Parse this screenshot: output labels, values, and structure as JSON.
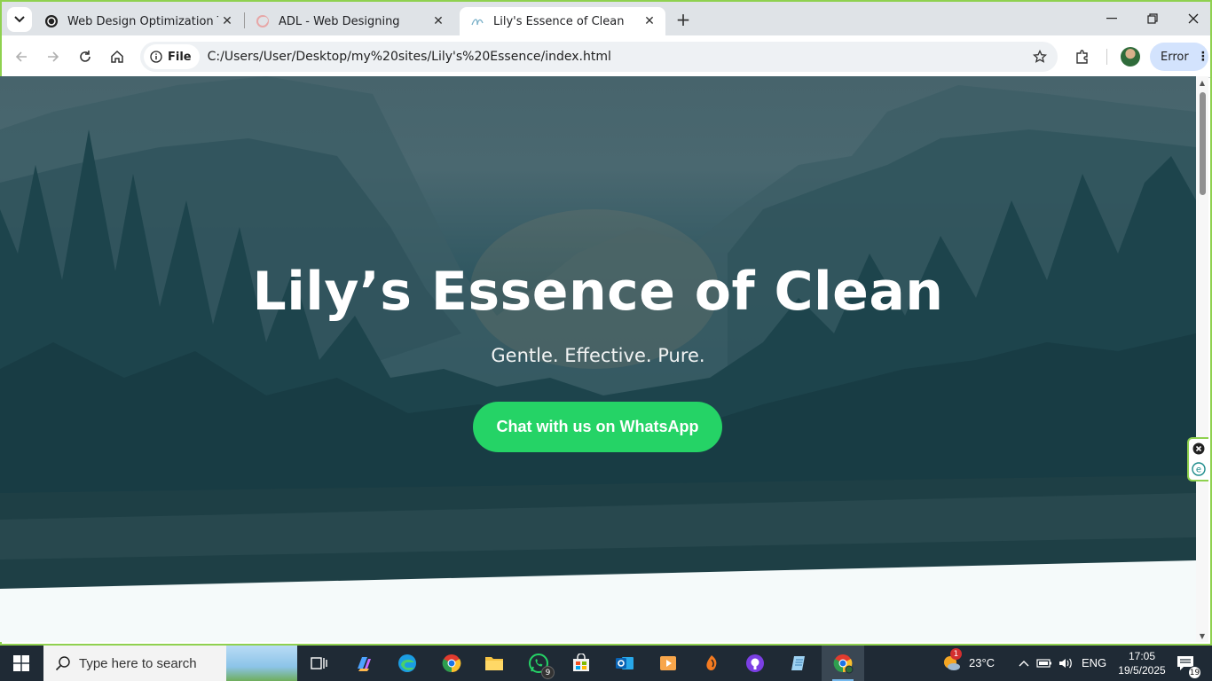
{
  "browser": {
    "tabs": [
      {
        "title": "Web Design Optimization Tips",
        "icon": "chatgpt-icon"
      },
      {
        "title": "ADL - Web Designing",
        "icon": "adl-icon"
      },
      {
        "title": "Lily's Essence of Clean",
        "icon": "lily-icon",
        "active": true
      }
    ],
    "address": {
      "scheme_label": "File",
      "url": "C:/Users/User/Desktop/my%20sites/Lily's%20Essence/index.html"
    },
    "profile_error_label": "Error"
  },
  "page": {
    "hero": {
      "title": "Lily’s Essence of Clean",
      "subtitle": "Gentle. Effective. Pure.",
      "cta_label": "Chat with us on WhatsApp",
      "cta_color": "#25d366"
    }
  },
  "taskbar": {
    "search_placeholder": "Type here to search",
    "whatsapp_badge": "9",
    "weather": {
      "temp": "23°C",
      "alert_count": "1"
    },
    "language": "ENG",
    "time": "17:05",
    "date": "19/5/2025",
    "notifications_count": "19"
  },
  "colors": {
    "window_border": "#8fd14f",
    "chrome_bg": "#dfe3e7",
    "error_chip": "#d3e3fd",
    "taskbar_bg": "#1f2a35"
  }
}
